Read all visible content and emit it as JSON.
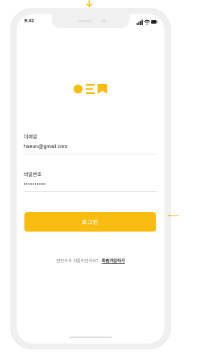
{
  "colors": {
    "accent": "#f8bd10",
    "frame": "#f0f0f0",
    "text": "#222222",
    "divider": "#e4e4e4"
  },
  "status_bar": {
    "time": "9:41",
    "icons": [
      "signal-icon",
      "wifi-icon",
      "battery-icon"
    ]
  },
  "logo": {
    "icon": "bookmark-logo"
  },
  "form": {
    "email_label": "이메일",
    "email_value": "haeun@gmail.com",
    "password_label": "비밀번호",
    "password_value": "••••••••••"
  },
  "login_button": {
    "label": "로그인"
  },
  "signup": {
    "question": "번틴즈가 처음이신가요?",
    "link": "회원가입하기"
  }
}
